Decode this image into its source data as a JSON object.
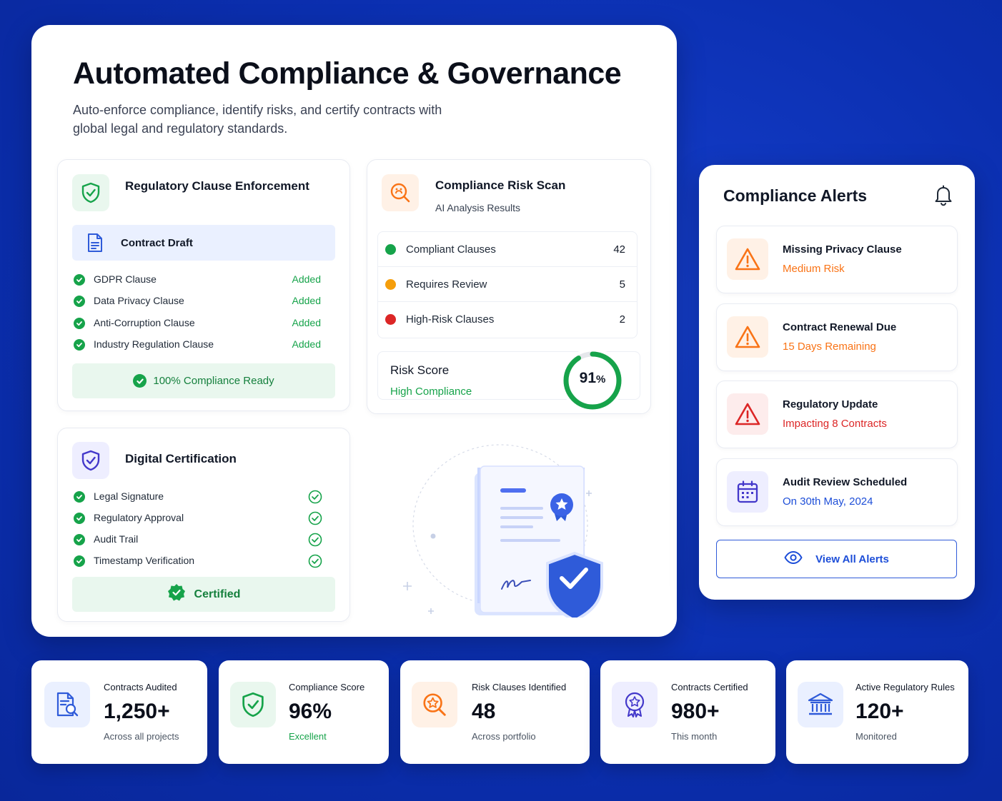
{
  "colors": {
    "background": "#0b2fb0",
    "success": "#16a34a",
    "warning": "#f59e0b",
    "warning_text": "#f97316",
    "danger": "#dc2626",
    "primary": "#1d4ed8"
  },
  "main": {
    "title": "Automated Compliance & Governance",
    "subtitle": "Auto-enforce compliance, identify risks, and certify contracts with global legal and regulatory standards."
  },
  "enforcement": {
    "icon": "shield-check-icon",
    "title": "Regulatory Clause Enforcement",
    "draft_icon": "document-icon",
    "draft_label": "Contract Draft",
    "clauses": [
      {
        "name": "GDPR Clause",
        "status": "Added"
      },
      {
        "name": "Data Privacy Clause",
        "status": "Added"
      },
      {
        "name": "Anti-Corruption Clause",
        "status": "Added"
      },
      {
        "name": "Industry Regulation Clause",
        "status": "Added"
      }
    ],
    "ready_label": "100% Compliance Ready"
  },
  "risk_scan": {
    "icon": "risk-search-icon",
    "title": "Compliance Risk Scan",
    "subtitle": "AI Analysis Results",
    "rows": [
      {
        "label": "Compliant Clauses",
        "count": "42",
        "color": "#16a34a"
      },
      {
        "label": "Requires Review",
        "count": "5",
        "color": "#f59e0b"
      },
      {
        "label": "High-Risk Clauses",
        "count": "2",
        "color": "#dc2626"
      }
    ],
    "score_label": "Risk Score",
    "score_status": "High Compliance",
    "score_value": "91",
    "score_unit": "%",
    "score_fraction": 0.91
  },
  "certification": {
    "icon": "shield-check-icon",
    "title": "Digital Certification",
    "items": [
      {
        "name": "Legal Signature"
      },
      {
        "name": "Regulatory Approval"
      },
      {
        "name": "Audit Trail"
      },
      {
        "name": "Timestamp Verification"
      }
    ],
    "certified_label": "Certified"
  },
  "alerts": {
    "title": "Compliance Alerts",
    "bell_icon": "bell-icon",
    "items": [
      {
        "icon": "warning-icon",
        "title": "Missing Privacy Clause",
        "subtitle": "Medium Risk",
        "color": "#f97316"
      },
      {
        "icon": "warning-icon",
        "title": "Contract Renewal Due",
        "subtitle": "15 Days Remaining",
        "color": "#f97316"
      },
      {
        "icon": "warning-icon",
        "title": "Regulatory Update",
        "subtitle": "Impacting 8 Contracts",
        "color": "#dc2626"
      },
      {
        "icon": "calendar-icon",
        "title": "Audit Review Scheduled",
        "subtitle": "On 30th May, 2024",
        "color": "#1d4ed8"
      }
    ],
    "view_all_label": "View All Alerts",
    "view_icon": "eye-icon"
  },
  "stats": [
    {
      "icon": "document-search-icon",
      "label": "Contracts Audited",
      "value": "1,250+",
      "sub": "Across all projects"
    },
    {
      "icon": "shield-check-icon",
      "label": "Compliance Score",
      "value": "96%",
      "sub": "Excellent"
    },
    {
      "icon": "risk-search-icon",
      "label": "Risk Clauses Identified",
      "value": "48",
      "sub": "Across portfolio"
    },
    {
      "icon": "award-icon",
      "label": "Contracts Certified",
      "value": "980+",
      "sub": "This month"
    },
    {
      "icon": "bank-icon",
      "label": "Active Regulatory Rules",
      "value": "120+",
      "sub": "Monitored"
    }
  ]
}
